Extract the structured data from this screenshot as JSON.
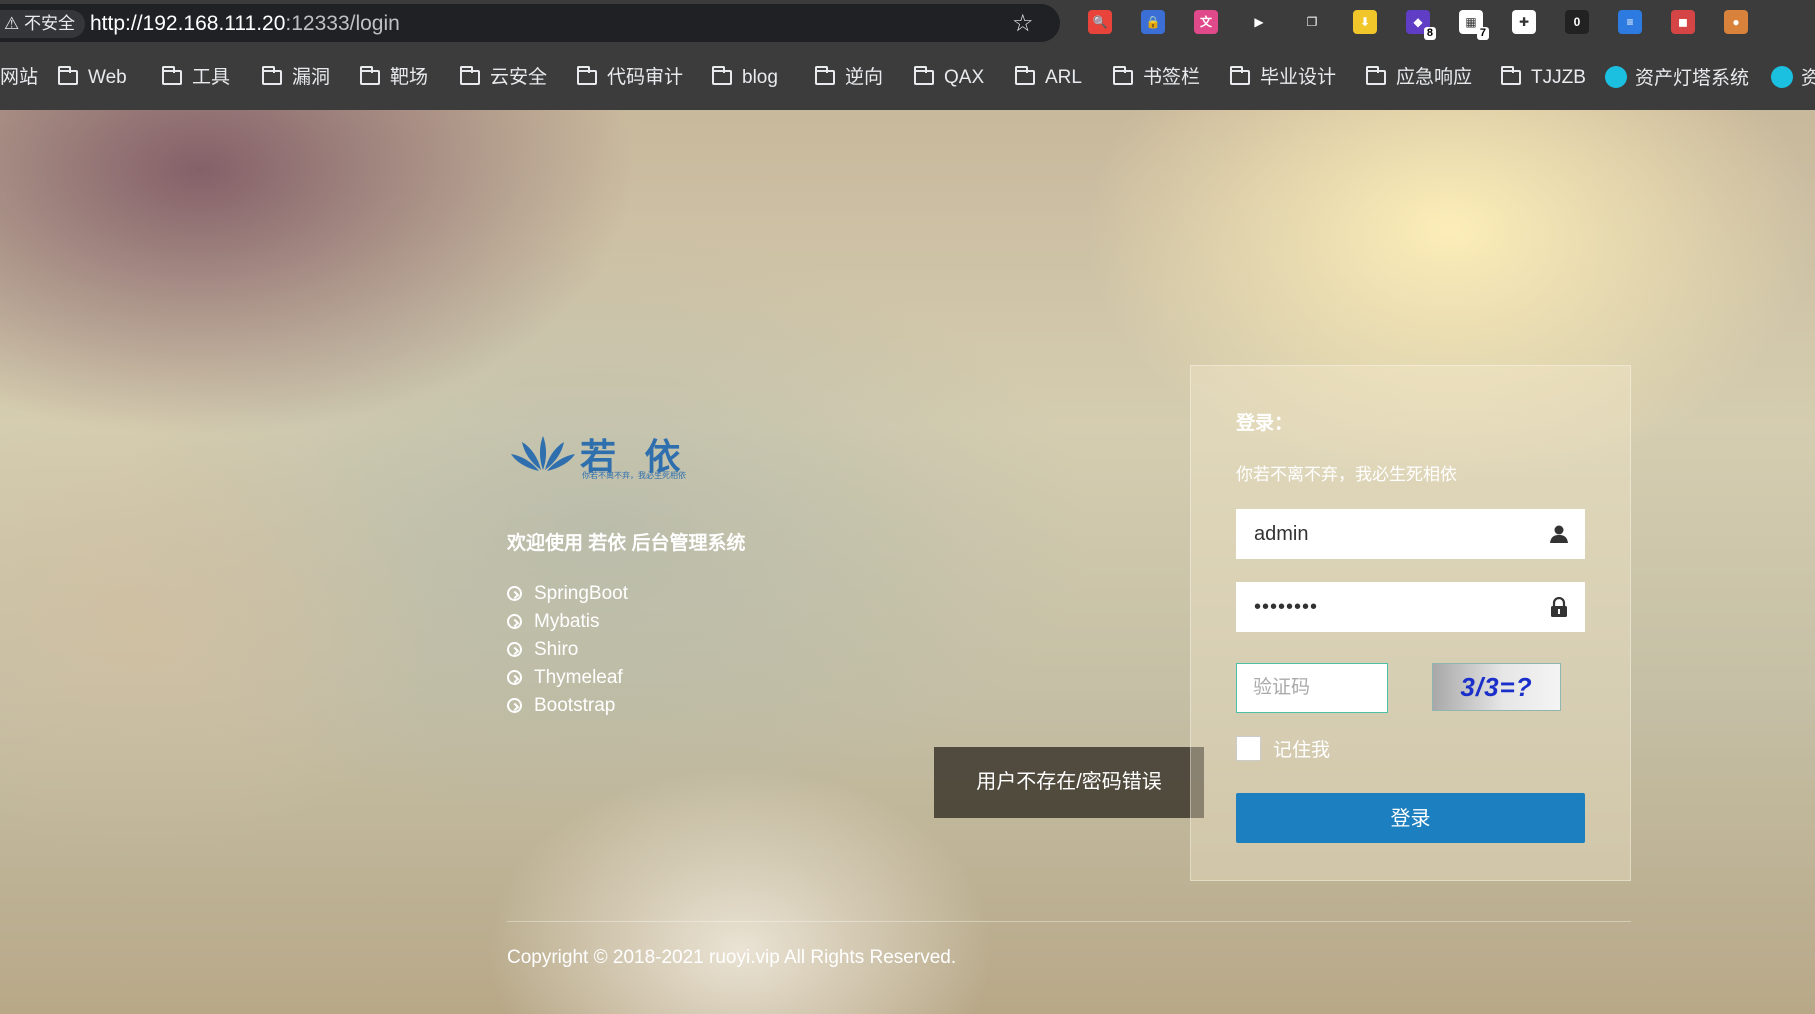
{
  "browser": {
    "security_label": "⚠ 不安全",
    "url_host": "http://192.168.111.20",
    "url_path": ":12333/login",
    "extensions": [
      {
        "name": "search-ext-icon",
        "color": "#e8443b",
        "glyph": "🔍"
      },
      {
        "name": "shield-ext-icon",
        "color": "#3b6fd6",
        "glyph": "🔒"
      },
      {
        "name": "translate-ext-icon",
        "color": "#e14a8a",
        "glyph": "文"
      },
      {
        "name": "play-ext-icon",
        "color": "#3c3c3c",
        "glyph": "▶"
      },
      {
        "name": "copy-ext-icon",
        "color": "#3c3c3c",
        "glyph": "❐"
      },
      {
        "name": "download-ext-icon",
        "color": "#f0c62b",
        "glyph": "⬇"
      },
      {
        "name": "proxy-ext-icon",
        "color": "#5f3dc4",
        "glyph": "◆",
        "badge": "8"
      },
      {
        "name": "screenshot-ext-icon",
        "color": "#ffffff",
        "glyph": "▦",
        "badge": "7"
      },
      {
        "name": "wechat-ext-icon",
        "color": "#ffffff",
        "glyph": "✚"
      },
      {
        "name": "counter-ext-icon",
        "color": "#222222",
        "glyph": "0"
      },
      {
        "name": "layout-ext-icon",
        "color": "#2d7be0",
        "glyph": "≡"
      },
      {
        "name": "mask-ext-icon",
        "color": "#d64545",
        "glyph": "◼"
      },
      {
        "name": "cookie-ext-icon",
        "color": "#d9823b",
        "glyph": "●"
      }
    ]
  },
  "bookmarks": [
    {
      "label": "网站",
      "type": "text"
    },
    {
      "label": "Web",
      "type": "folder"
    },
    {
      "label": "工具",
      "type": "folder"
    },
    {
      "label": "漏洞",
      "type": "folder"
    },
    {
      "label": "靶场",
      "type": "folder"
    },
    {
      "label": "云安全",
      "type": "folder"
    },
    {
      "label": "代码审计",
      "type": "folder"
    },
    {
      "label": "blog",
      "type": "folder"
    },
    {
      "label": "逆向",
      "type": "folder"
    },
    {
      "label": "QAX",
      "type": "folder"
    },
    {
      "label": "ARL",
      "type": "folder"
    },
    {
      "label": "书签栏",
      "type": "folder"
    },
    {
      "label": "毕业设计",
      "type": "folder"
    },
    {
      "label": "应急响应",
      "type": "folder"
    },
    {
      "label": "TJJZB",
      "type": "folder"
    },
    {
      "label": "资产灯塔系统",
      "type": "site"
    },
    {
      "label": "资",
      "type": "site"
    }
  ],
  "page": {
    "logo_text": "若 依",
    "logo_sub": "你若不离不弃，我必生死相依",
    "welcome": "欢迎使用 若依 后台管理系统",
    "features": [
      "SpringBoot",
      "Mybatis",
      "Shiro",
      "Thymeleaf",
      "Bootstrap"
    ],
    "toast": "用户不存在/密码错误",
    "copyright": "Copyright © 2018-2021 ruoyi.vip All Rights Reserved."
  },
  "login": {
    "title": "登录：",
    "subtitle": "你若不离不弃，我必生死相依",
    "username": "admin",
    "password": "••••••••",
    "captcha_placeholder": "验证码",
    "captcha_text": "3/3=?",
    "remember_label": "记住我",
    "submit_label": "登录"
  }
}
